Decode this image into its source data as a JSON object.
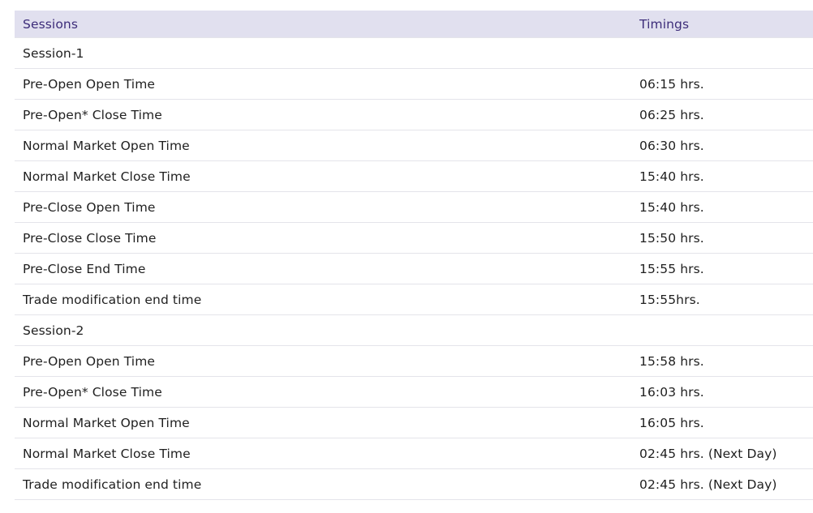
{
  "table": {
    "headers": [
      "Sessions",
      "Timings"
    ],
    "rows": [
      [
        "Session-1",
        ""
      ],
      [
        "Pre-Open Open Time",
        "06:15 hrs."
      ],
      [
        "Pre-Open* Close Time",
        "06:25 hrs."
      ],
      [
        "Normal Market Open Time",
        "06:30 hrs."
      ],
      [
        "Normal Market Close Time",
        "15:40 hrs."
      ],
      [
        "Pre-Close Open Time",
        "15:40 hrs."
      ],
      [
        "Pre-Close Close Time",
        "15:50 hrs."
      ],
      [
        "Pre-Close End Time",
        "15:55 hrs."
      ],
      [
        "Trade modification end time",
        "15:55hrs."
      ],
      [
        "Session-2",
        ""
      ],
      [
        "Pre-Open Open Time",
        "15:58 hrs."
      ],
      [
        "Pre-Open* Close Time",
        "16:03 hrs."
      ],
      [
        "Normal Market Open Time",
        "16:05 hrs."
      ],
      [
        "Normal Market Close Time",
        "02:45 hrs. (Next Day)"
      ],
      [
        "Trade modification end time",
        "02:45 hrs. (Next Day)"
      ]
    ]
  },
  "colors": {
    "header_bg": "#e1e0ef",
    "header_text": "#3d2d7a",
    "border": "#e4e4ea",
    "text": "#1f1f1f"
  }
}
